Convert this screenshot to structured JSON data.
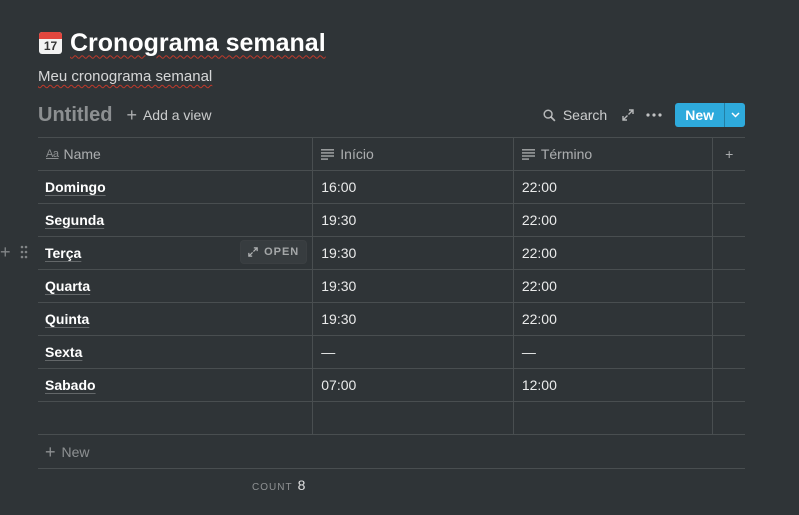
{
  "page": {
    "icon": "calendar-icon",
    "calendar_icon_day": "17",
    "title": "Cronograma semanal",
    "subtitle": "Meu cronograma semanal"
  },
  "database": {
    "title": "Untitled",
    "add_view_label": "Add a view",
    "search_label": "Search",
    "new_label": "New",
    "accent_color": "#2eaadc"
  },
  "table": {
    "columns": [
      {
        "label": "Name",
        "icon": "text-aa-icon"
      },
      {
        "label": "Início",
        "icon": "text-lines-icon"
      },
      {
        "label": "Término",
        "icon": "text-lines-icon"
      }
    ],
    "rows": [
      {
        "name": "Domingo",
        "inicio": "16:00",
        "termino": "22:00"
      },
      {
        "name": "Segunda",
        "inicio": "19:30",
        "termino": "22:00"
      },
      {
        "name": "Terça",
        "inicio": "19:30",
        "termino": "22:00"
      },
      {
        "name": "Quarta",
        "inicio": "19:30",
        "termino": "22:00"
      },
      {
        "name": "Quinta",
        "inicio": "19:30",
        "termino": "22:00"
      },
      {
        "name": "Sexta",
        "inicio": "—",
        "termino": "—"
      },
      {
        "name": "Sabado",
        "inicio": "07:00",
        "termino": "12:00"
      },
      {
        "name": "",
        "inicio": "",
        "termino": ""
      }
    ],
    "open_label": "OPEN",
    "add_row_label": "New",
    "count_label": "COUNT",
    "count_value": "8"
  }
}
